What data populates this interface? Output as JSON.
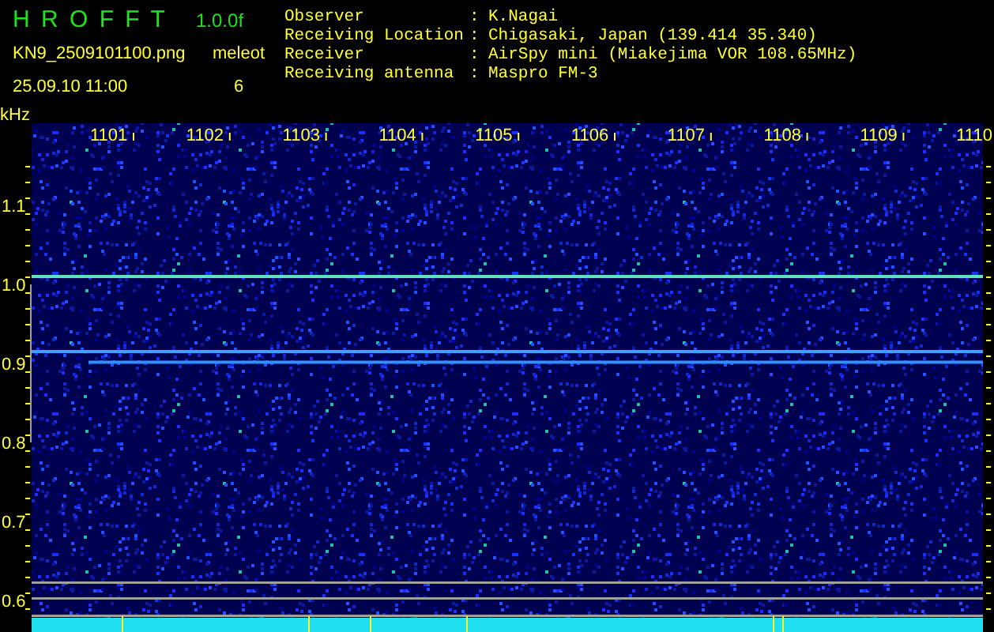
{
  "header": {
    "title": "H R O F F T",
    "version": "1.0.0f",
    "filename": "KN9_2509101100.png",
    "count_label": "meleot",
    "timestamp": "25.09.10 11:00",
    "count": "6"
  },
  "info": [
    {
      "label": "Observer",
      "separator": ":",
      "value": "K.Nagai"
    },
    {
      "label": "Receiving Location",
      "separator": ":",
      "value": "Chigasaki, Japan (139.414 35.340)"
    },
    {
      "label": "Receiver",
      "separator": ":",
      "value": "AirSpy mini (Miakejima VOR 108.65MHz)"
    },
    {
      "label": "Receiving antenna",
      "separator": ":",
      "value": "Maspro FM-3"
    }
  ],
  "spectrogram": {
    "unit": "kHz",
    "x_labels": [
      "1101",
      "1102",
      "1103",
      "1104",
      "1105",
      "1106",
      "1107",
      "1108",
      "1109",
      "1110"
    ],
    "y_labels": [
      "1.1",
      "1.0",
      "0.9",
      "0.8",
      "0.7",
      "0.6"
    ]
  }
}
